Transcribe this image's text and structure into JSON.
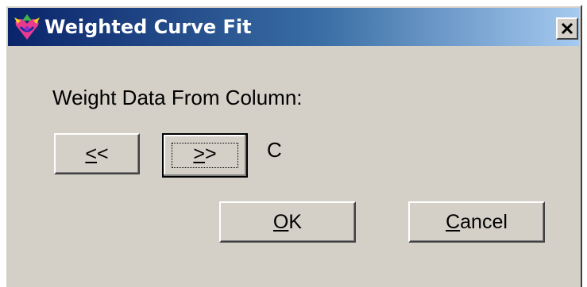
{
  "window": {
    "title": "Weighted Curve Fit",
    "close_glyph": "✕",
    "app_icon": "curve-fit-app-icon"
  },
  "dialog": {
    "prompt": "Weight Data From Column:",
    "prev_button": {
      "accel": "<",
      "rest": "<"
    },
    "next_button": {
      "accel": ">",
      "rest": ">"
    },
    "column_value": "C",
    "ok_button": {
      "accel": "O",
      "rest": "K"
    },
    "cancel_button": {
      "accel": "C",
      "rest": "ancel"
    }
  },
  "colors": {
    "face": "#d4d0c8",
    "title_start": "#0a246a",
    "title_end": "#a6caf0"
  }
}
